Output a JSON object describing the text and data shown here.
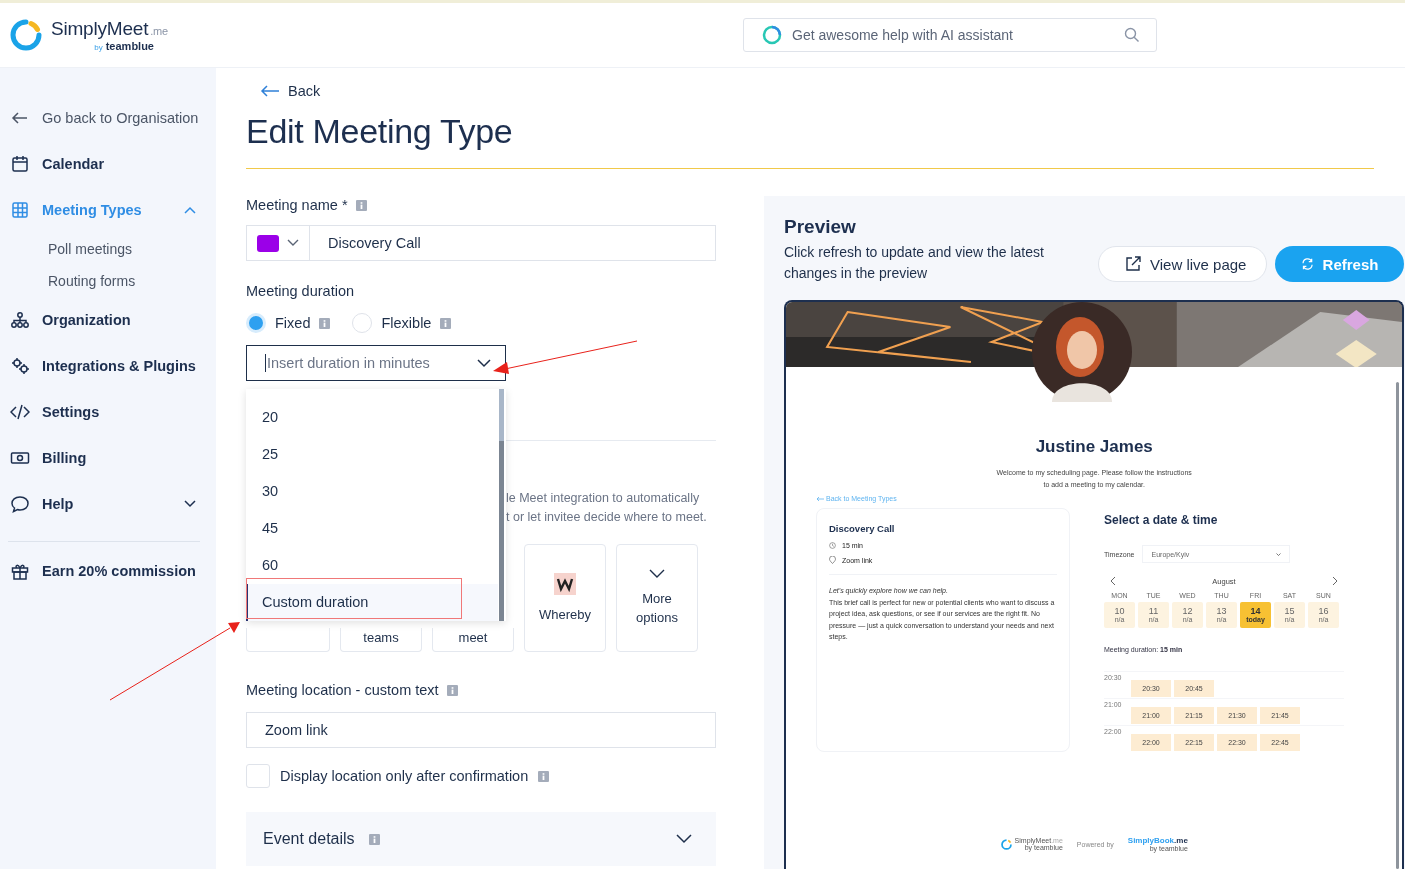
{
  "header": {
    "logo": {
      "name": "SimplyMeet",
      "suffix": ".me",
      "by": "by",
      "brand": "teamblue"
    },
    "search": {
      "placeholder": "Get awesome help with AI assistant"
    }
  },
  "sidebar": {
    "items": [
      {
        "kind": "back",
        "label": "Go back to Organisation",
        "selected": false
      },
      {
        "kind": "calendar",
        "label": "Calendar",
        "selected": false
      },
      {
        "kind": "grid",
        "label": "Meeting Types",
        "selected": true,
        "expanded": true,
        "children": [
          {
            "label": "Poll meetings",
            "selected": false
          },
          {
            "label": "Routing forms",
            "selected": false
          }
        ]
      },
      {
        "kind": "org",
        "label": "Organization",
        "selected": false
      },
      {
        "kind": "plugins",
        "label": "Integrations & Plugins",
        "selected": false
      },
      {
        "kind": "code",
        "label": "Settings",
        "selected": false
      },
      {
        "kind": "billing",
        "label": "Billing",
        "selected": false
      },
      {
        "kind": "help",
        "label": "Help",
        "selected": false,
        "expanded": false
      },
      {
        "kind": "gift",
        "label": "Earn 20% commission",
        "selected": false
      }
    ]
  },
  "main": {
    "back": "Back",
    "title": "Edit Meeting Type",
    "name_field": {
      "label": "Meeting name *",
      "color": "#9b00e8",
      "value": "Discovery Call"
    },
    "duration": {
      "label": "Meeting duration",
      "options": [
        {
          "label": "Fixed",
          "selected": true
        },
        {
          "label": "Flexible",
          "selected": false
        }
      ],
      "select": {
        "placeholder": "Insert duration in minutes",
        "open": true,
        "options": [
          {
            "label": "20",
            "selected": false
          },
          {
            "label": "25",
            "selected": false
          },
          {
            "label": "30",
            "selected": false
          },
          {
            "label": "45",
            "selected": false
          },
          {
            "label": "60",
            "selected": false
          },
          {
            "label": "Custom duration",
            "selected": true
          }
        ]
      }
    },
    "location": {
      "description_lines": [
        "le Meet integration to automatically",
        "t or let invitee decide where to meet."
      ],
      "cards": [
        {
          "kind": "blank"
        },
        {
          "kind": "text",
          "label": "teams"
        },
        {
          "kind": "text",
          "label": "meet"
        },
        {
          "kind": "whereby",
          "label": "Whereby"
        },
        {
          "kind": "more",
          "label": "More options"
        }
      ]
    },
    "custom_text": {
      "label": "Meeting location - custom text",
      "value": "Zoom link"
    },
    "confirm": {
      "label": "Display location only after confirmation",
      "checked": false
    },
    "event_details": {
      "label": "Event details",
      "expanded": false
    }
  },
  "preview": {
    "title": "Preview",
    "description": "Click refresh to update and view the latest changes in the preview",
    "buttons": [
      {
        "kind": "outline",
        "label": "View live page"
      },
      {
        "kind": "primary",
        "label": "Refresh"
      }
    ],
    "page": {
      "name": "Justine James",
      "welcome": "Welcome to my scheduling page. Please follow the instructions to add a meeting to my calendar.",
      "back_link": "Back to Meeting Types",
      "card": {
        "title": "Discovery Call",
        "duration": "15 min",
        "location": "Zoom link",
        "lead": "Let’s quickly explore how we can help.",
        "text": "This brief call is perfect for new or potential clients who want to discuss a project idea, ask questions, or see if our services are the right fit. No pressure — just a quick conversation to understand your needs and next steps."
      },
      "booking": {
        "title": "Select a date & time",
        "timezone_label": "Timezone",
        "timezone": "Europe/Kyiv",
        "month": "August",
        "days": [
          {
            "dow": "MON",
            "day": "10",
            "note": "n/a",
            "selected": false
          },
          {
            "dow": "TUE",
            "day": "11",
            "note": "n/a",
            "selected": false
          },
          {
            "dow": "WED",
            "day": "12",
            "note": "n/a",
            "selected": false
          },
          {
            "dow": "THU",
            "day": "13",
            "note": "n/a",
            "selected": false
          },
          {
            "dow": "FRI",
            "day": "14",
            "note": "today",
            "selected": true
          },
          {
            "dow": "SAT",
            "day": "15",
            "note": "n/a",
            "selected": false
          },
          {
            "dow": "SUN",
            "day": "16",
            "note": "n/a",
            "selected": false
          }
        ],
        "duration_text": "Meeting duration: **15 min**",
        "slot_groups": [
          {
            "hour": "20:30",
            "slots": [
              "20:30",
              "20:45"
            ]
          },
          {
            "hour": "21:00",
            "slots": [
              "21:00",
              "21:15",
              "21:30",
              "21:45"
            ]
          },
          {
            "hour": "22:00",
            "slots": [
              "22:00",
              "22:15",
              "22:30",
              "22:45"
            ]
          }
        ]
      },
      "footer": {
        "logo": "SimplyMeet",
        "logo_suffix": ".me",
        "logo_by": "by teamblue",
        "powered": "Powered by",
        "brand": "SimplyBook",
        "brand_suffix": ".me",
        "brand_by": "by teamblue"
      }
    }
  }
}
